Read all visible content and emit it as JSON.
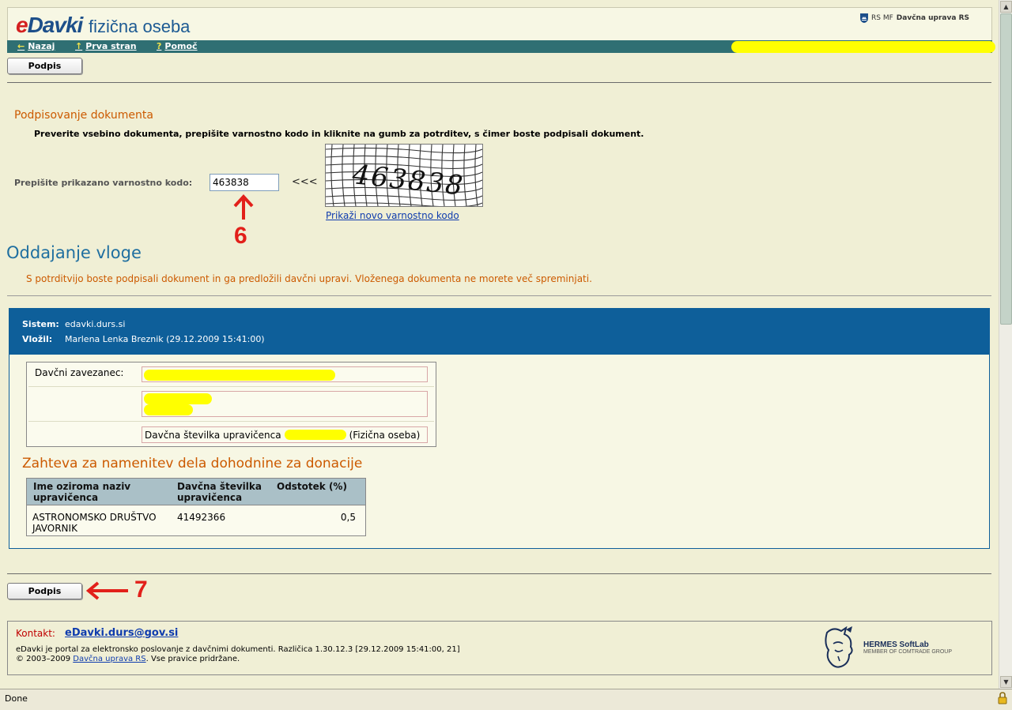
{
  "header": {
    "logo_e": "e",
    "logo_davki": "Davki",
    "subtitle": "fizična oseba",
    "org_short": "RS MF",
    "org_name": "Davčna uprava RS"
  },
  "nav": {
    "back": "Nazaj",
    "home": "Prva stran",
    "help": "Pomoč",
    "back_icon": "←",
    "home_icon": "↑",
    "help_icon": "?"
  },
  "toolbar": {
    "sign_label": "Podpis"
  },
  "signing": {
    "heading": "Podpisovanje dokumenta",
    "instructions": "Preverite vsebino dokumenta, prepišite varnostno kodo in kliknite na gumb za potrditev, s čimer boste podpisali dokument.",
    "code_label": "Prepišite prikazano varnostno kodo:",
    "code_value": "463838",
    "arrows": "<<<",
    "captcha_text": "463838",
    "new_code_link": "Prikaži novo varnostno kodo"
  },
  "annotations": {
    "step6": "6",
    "step7": "7"
  },
  "submission": {
    "heading": "Oddajanje vloge",
    "note": "S potrditvijo boste podpisali dokument in ga predložili davčni upravi. Vloženega dokumenta ne morete več spreminjati."
  },
  "document": {
    "system_label": "Sistem:",
    "system_value": "edavki.durs.si",
    "filed_label": "Vložil:",
    "filed_value": "Marlena Lenka Breznik  (29.12.2009 15:41:00)",
    "taxpayer_label": "Davčni zavezanec:",
    "tax_number_prefix": "Davčna številka upravičenca",
    "tax_number_suffix": "(Fizična oseba)",
    "donation_heading": "Zahteva za namenitev dela dohodnine za donacije",
    "table": {
      "headers": [
        "Ime oziroma naziv upravičenca",
        "Davčna številka upravičenca",
        "Odstotek (%)"
      ],
      "rows": [
        {
          "name": "ASTRONOMSKO DRUŠTVO JAVORNIK",
          "tax_number": "41492366",
          "percent": "0,5"
        }
      ]
    }
  },
  "footer": {
    "contact_label": "Kontakt:",
    "contact_email": "eDavki.durs@gov.si",
    "line1": "eDavki je portal za elektronsko poslovanje z davčnimi dokumenti. Različica 1.30.12.3 [29.12.2009 15:41:00, 21]",
    "line2_prefix": "© 2003–2009",
    "line2_link": "Davčna uprava RS",
    "line2_suffix": ". Vse pravice pridržane.",
    "brand": "HERMES SoftLab",
    "brand_sub": "MEMBER OF COMTRADE GROUP"
  },
  "status": {
    "text": "Done"
  },
  "colors": {
    "page_bg": "#f0efd5",
    "nav_bg": "#2f6f73",
    "panel_head": "#0e5f9a",
    "accent_orange": "#cc5a00",
    "annotation_red": "#e2201a",
    "redaction": "#ffff00"
  }
}
